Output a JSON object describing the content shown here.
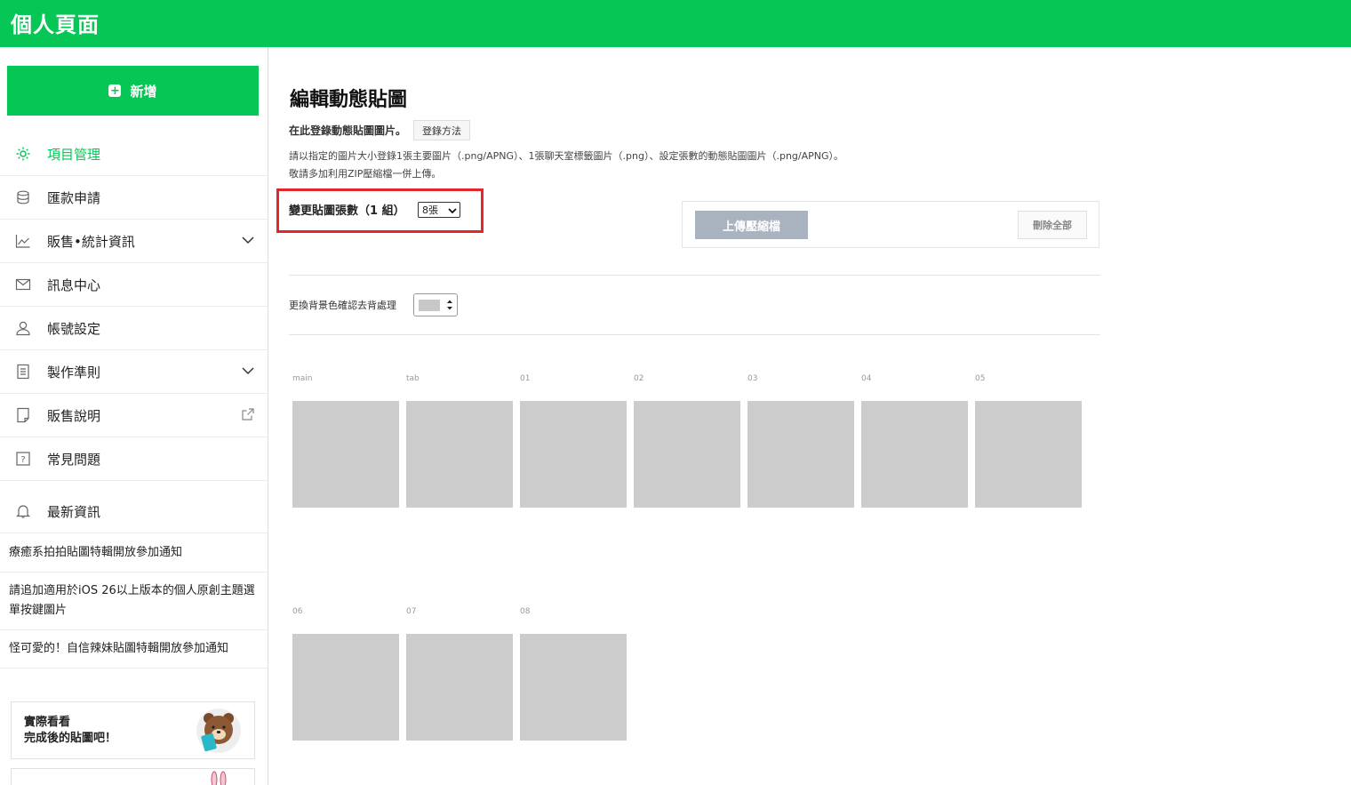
{
  "header": {
    "title": "個人頁面"
  },
  "sidebar": {
    "add_label": "新增",
    "items": [
      {
        "label": "項目管理"
      },
      {
        "label": "匯款申請"
      },
      {
        "label": "販售•統計資訊"
      },
      {
        "label": "訊息中心"
      },
      {
        "label": "帳號設定"
      },
      {
        "label": "製作準則"
      },
      {
        "label": "販售說明"
      },
      {
        "label": "常見問題"
      },
      {
        "label": "最新資訊"
      }
    ],
    "news": [
      "療癒系拍拍貼圖特輯開放參加通知",
      "請追加適用於iOS 26以上版本的個人原創主題選單按鍵圖片",
      "怪可愛的！自信辣妹貼圖特輯開放參加通知"
    ],
    "promo": {
      "line1": "實際看看",
      "line2": "完成後的貼圖吧！"
    }
  },
  "main": {
    "title": "編輯動態貼圖",
    "subtitle": "在此登錄動態貼圖圖片。",
    "how_to_label": "登錄方法",
    "desc_line1": "請以指定的圖片大小登錄1張主要圖片（.png/APNG）、1張聊天室標籤圖片（.png）、設定張數的動態貼圖圖片（.png/APNG）。",
    "desc_line2": "敬請多加利用ZIP壓縮檔一併上傳。",
    "count_label": "變更貼圖張數（1 組）",
    "count_value": "8張",
    "upload_label": "上傳壓縮檔",
    "delete_all_label": "刪除全部",
    "bg_label": "更換背景色確認去背處理",
    "slots": [
      "main",
      "tab",
      "01",
      "02",
      "03",
      "04",
      "05",
      "06",
      "07",
      "08"
    ]
  },
  "colors": {
    "brand_green": "#06c755",
    "highlight_red": "#e2262c",
    "slot_gray": "#cccccc"
  }
}
